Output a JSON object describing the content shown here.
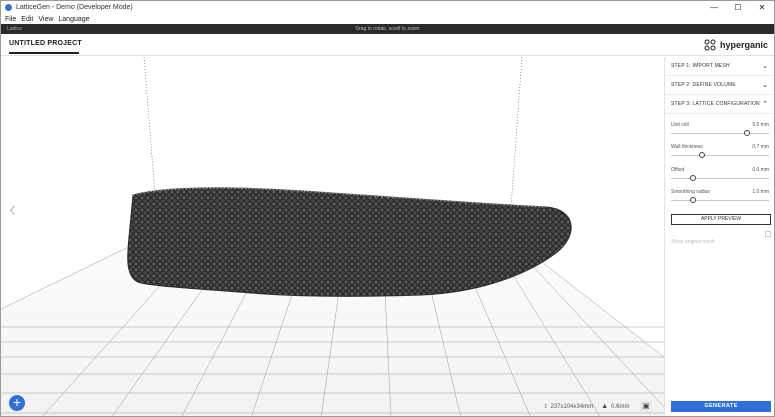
{
  "window": {
    "title": "LatticeGen - Demo (Developer Mode)",
    "controls": [
      "—",
      "☐",
      "✕"
    ]
  },
  "menu": [
    "File",
    "Edit",
    "View",
    "Language"
  ],
  "toolbar": {
    "left_label": "Lattice",
    "center_label": "Drag to rotate, scroll to zoom"
  },
  "project": {
    "tab_label": "UNTITLED PROJECT"
  },
  "brand": {
    "name": "hyperganic",
    "color": "#2f6fd8"
  },
  "panel": {
    "steps": [
      {
        "label": "STEP 1: IMPORT MESH"
      },
      {
        "label": "STEP 2: DEFINE VOLUME"
      },
      {
        "label": "STEP 3: LATTICE CONFIGURATION"
      }
    ],
    "params": [
      {
        "label": "Unit cell",
        "value": "5.0 mm",
        "level": 0.78
      },
      {
        "label": "Wall thickness",
        "value": "0.7 mm",
        "level": 0.32
      },
      {
        "label": "Offset",
        "value": "0.0 mm",
        "level": 0.22
      },
      {
        "label": "Smoothing radius",
        "value": "1.0 mm",
        "level": 0.22
      }
    ],
    "apply_label": "APPLY PREVIEW",
    "toggle_label": "Show original mesh",
    "generate_label": "GENERATE"
  },
  "viewport": {
    "nav_left": "‹",
    "add_label": "+",
    "dims_icon": "ruler-icon",
    "dims_value": "237x104x34mm",
    "layers_icon": "layers-icon",
    "layers_value": "0.6mm",
    "accent": "#2f6fd8"
  }
}
